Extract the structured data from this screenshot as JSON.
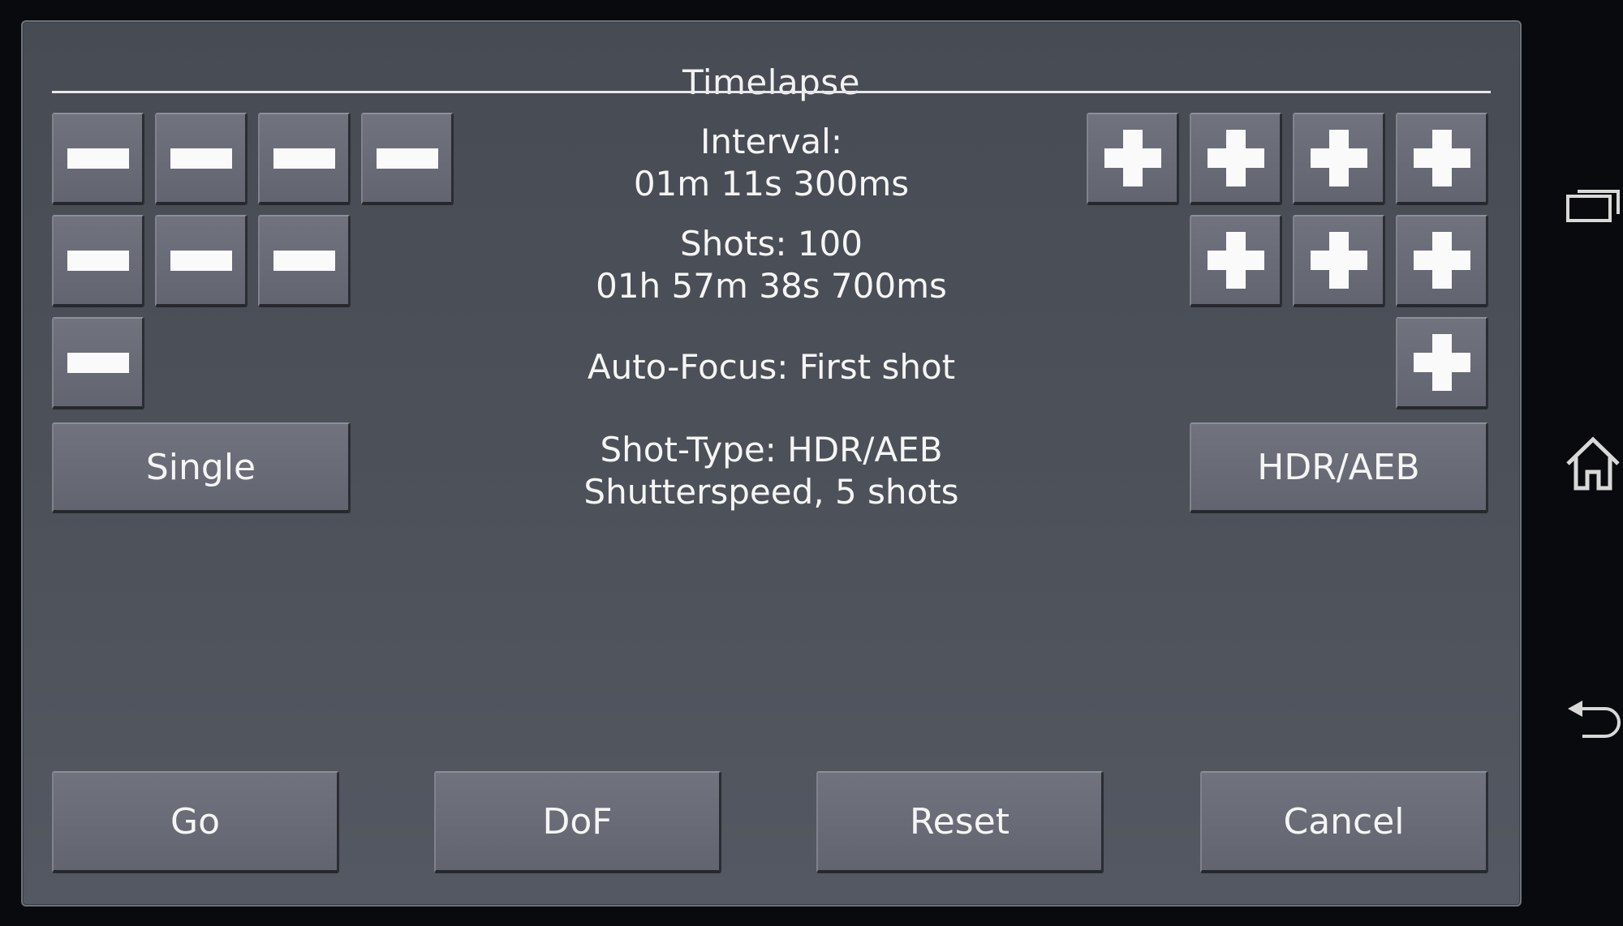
{
  "dialog": {
    "title": "Timelapse"
  },
  "interval": {
    "label": "Interval:",
    "value": "01m 11s 300ms"
  },
  "shots": {
    "label": "Shots: 100",
    "duration": "01h 57m 38s 700ms"
  },
  "autofocus": {
    "label": "Auto-Focus: First shot"
  },
  "shot_type": {
    "label": "Shot-Type: HDR/AEB",
    "detail": "Shutterspeed, 5 shots",
    "left_button": "Single",
    "right_button": "HDR/AEB"
  },
  "actions": {
    "go": "Go",
    "dof": "DoF",
    "reset": "Reset",
    "cancel": "Cancel"
  },
  "icons": {
    "minus": "minus-icon",
    "plus": "plus-icon",
    "recents": "recent-apps-icon",
    "home": "home-icon",
    "back": "back-icon"
  },
  "colors": {
    "dialog_bg": "#4d5159",
    "button_bg": "#686b75",
    "text": "#f5f5f5",
    "screen_bg": "#080a0d"
  }
}
